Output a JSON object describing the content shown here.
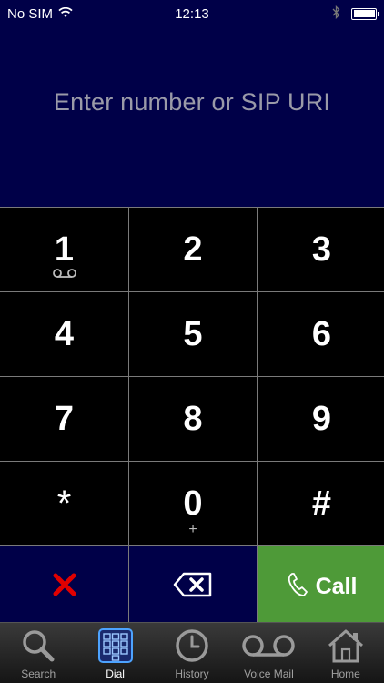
{
  "status_bar": {
    "carrier": "No SIM",
    "time": "12:13"
  },
  "display": {
    "placeholder": "Enter number or SIP URI"
  },
  "keypad": {
    "keys": [
      {
        "digit": "1",
        "sub_icon": "voicemail-icon"
      },
      {
        "digit": "2"
      },
      {
        "digit": "3"
      },
      {
        "digit": "4"
      },
      {
        "digit": "5"
      },
      {
        "digit": "6"
      },
      {
        "digit": "7"
      },
      {
        "digit": "8"
      },
      {
        "digit": "9"
      },
      {
        "digit": "*"
      },
      {
        "digit": "0",
        "sub": "+"
      },
      {
        "digit": "#"
      }
    ],
    "clear_icon": "x-icon",
    "backspace_icon": "backspace-icon",
    "call_label": "Call"
  },
  "tab_bar": {
    "tabs": [
      {
        "label": "Search",
        "icon": "search-icon",
        "active": false
      },
      {
        "label": "Dial",
        "icon": "dialpad-icon",
        "active": true
      },
      {
        "label": "History",
        "icon": "clock-icon",
        "active": false
      },
      {
        "label": "Voice Mail",
        "icon": "voicemail-icon",
        "active": false
      },
      {
        "label": "Home",
        "icon": "home-icon",
        "active": false
      }
    ]
  },
  "colors": {
    "header_bg": "#000048",
    "call_green": "#4e9a38",
    "clear_red": "#e00000"
  }
}
